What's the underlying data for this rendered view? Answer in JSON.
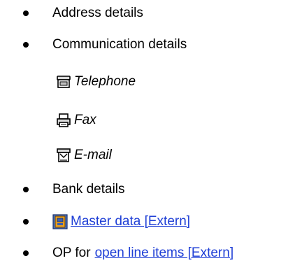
{
  "items": {
    "address": "Address details",
    "communication": "Communication details",
    "telephone": "Telephone",
    "fax": "Fax",
    "email": "E-mail",
    "bank": "Bank details",
    "master_data_link": "Master data [Extern]",
    "op_prefix": "OP for",
    "op_link": "open line items [Extern]"
  },
  "icons": {
    "telephone": "telephone-icon",
    "fax": "fax-icon",
    "email": "email-icon",
    "master_data": "master-data-icon"
  },
  "colors": {
    "link": "#1f3fd6",
    "text": "#000000"
  }
}
